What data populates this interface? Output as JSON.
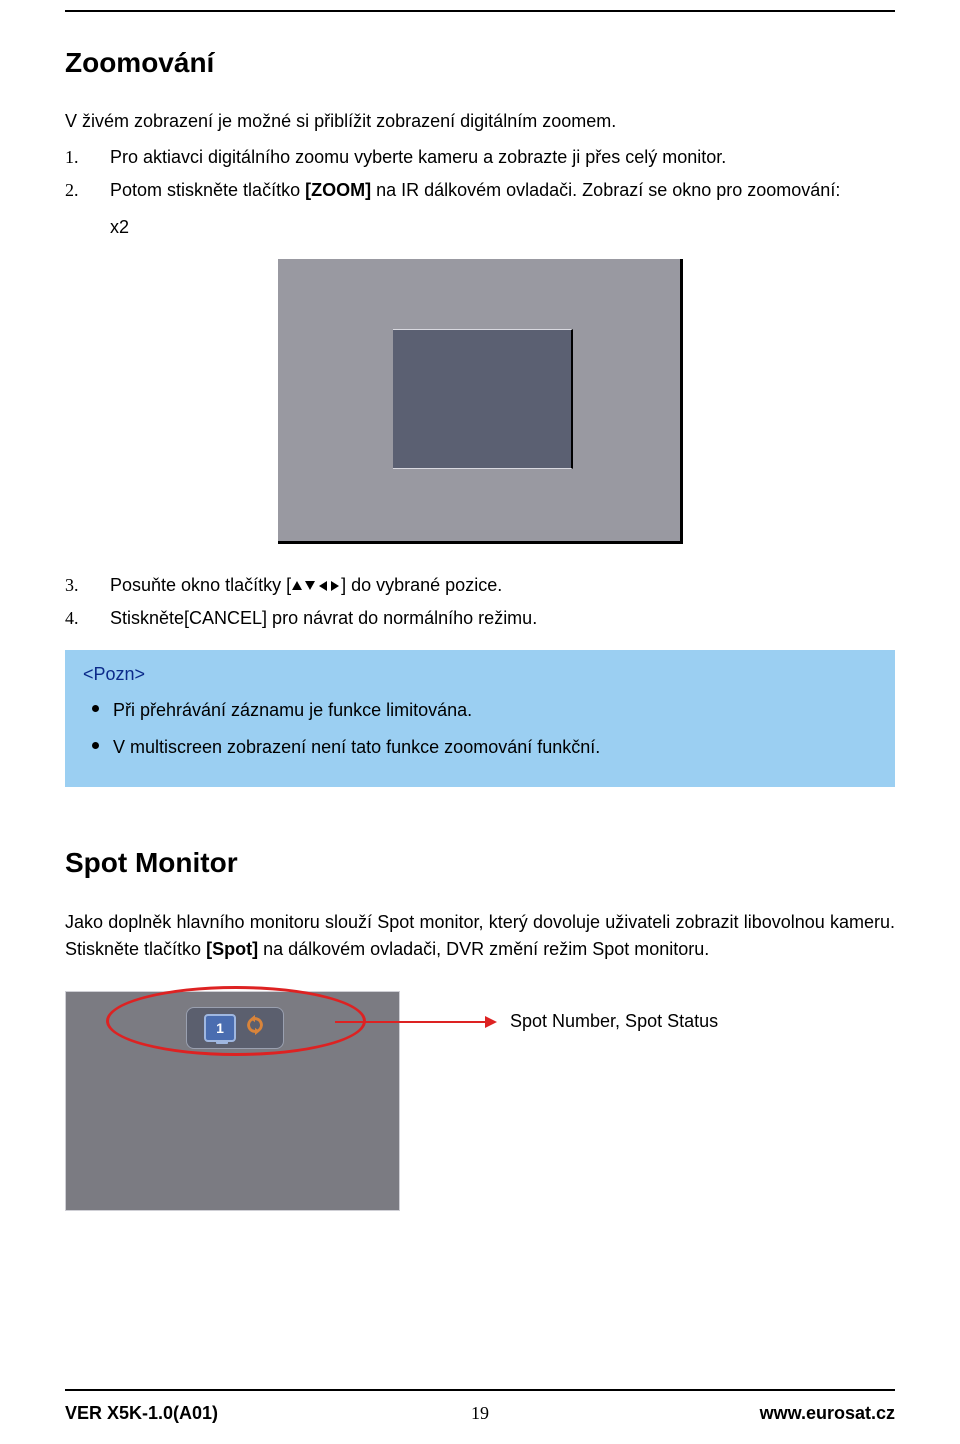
{
  "section1": {
    "title": "Zoomování",
    "lead": "V živém zobrazení je možné si přiblížit zobrazení digitálním zoomem.",
    "step1_num": "1.",
    "step1": "Pro aktiavci digitálního zoomu vyberte kameru a zobrazte ji přes celý monitor.",
    "step2_num": "2.",
    "step2_pre": "Potom stiskněte tlačítko ",
    "step2_bold": "[ZOOM]",
    "step2_post": " na IR dálkovém ovladači. Zobrazí se okno pro zoomování:",
    "step2_x2": "x2",
    "step3_num": "3.",
    "step3_pre": "Posuňte okno tlačítky [",
    "step3_post": "] do vybrané pozice.",
    "step4_num": "4.",
    "step4": "Stiskněte[CANCEL] pro návrat do normálního režimu."
  },
  "note": {
    "title": "<Pozn>",
    "items": [
      "Při přehrávání záznamu je funkce limitována.",
      "V multiscreen zobrazení není tato funkce zoomování funkční."
    ]
  },
  "section2": {
    "title": "Spot Monitor",
    "para_pre": "Jako doplněk hlavního monitoru slouží Spot monitor, který dovoluje uživateli zobrazit libovolnou kameru. Stiskněte tlačítko ",
    "para_bold": "[Spot]",
    "para_post": " na dálkovém ovladači, DVR změní režim Spot monitoru.",
    "spot_num": "1",
    "callout": "Spot Number, Spot Status"
  },
  "footer": {
    "left": "VER X5K-1.0(A01)",
    "center": "19",
    "right": "www.eurosat.cz"
  }
}
